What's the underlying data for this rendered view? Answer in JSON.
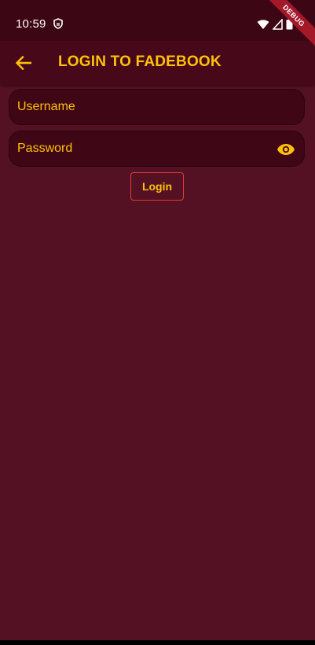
{
  "status_bar": {
    "time": "10:59",
    "icons": [
      "shield-icon",
      "wifi-icon",
      "signal-icon",
      "battery-icon"
    ]
  },
  "debug_banner": "DEBUG",
  "app_bar": {
    "back_icon": "arrow-back-icon",
    "title": "LOGIN TO FADEBOOK"
  },
  "form": {
    "username": {
      "placeholder": "Username",
      "value": ""
    },
    "password": {
      "placeholder": "Password",
      "value": "",
      "toggle_icon": "eye-icon"
    },
    "login_label": "Login"
  },
  "colors": {
    "background": "#541124",
    "app_bar": "#47091a",
    "status_bar": "#3d0614",
    "field_fill": "#3f0715",
    "accent": "#ffc107",
    "button_border": "#e53935",
    "debug_ribbon": "#a3192a"
  }
}
